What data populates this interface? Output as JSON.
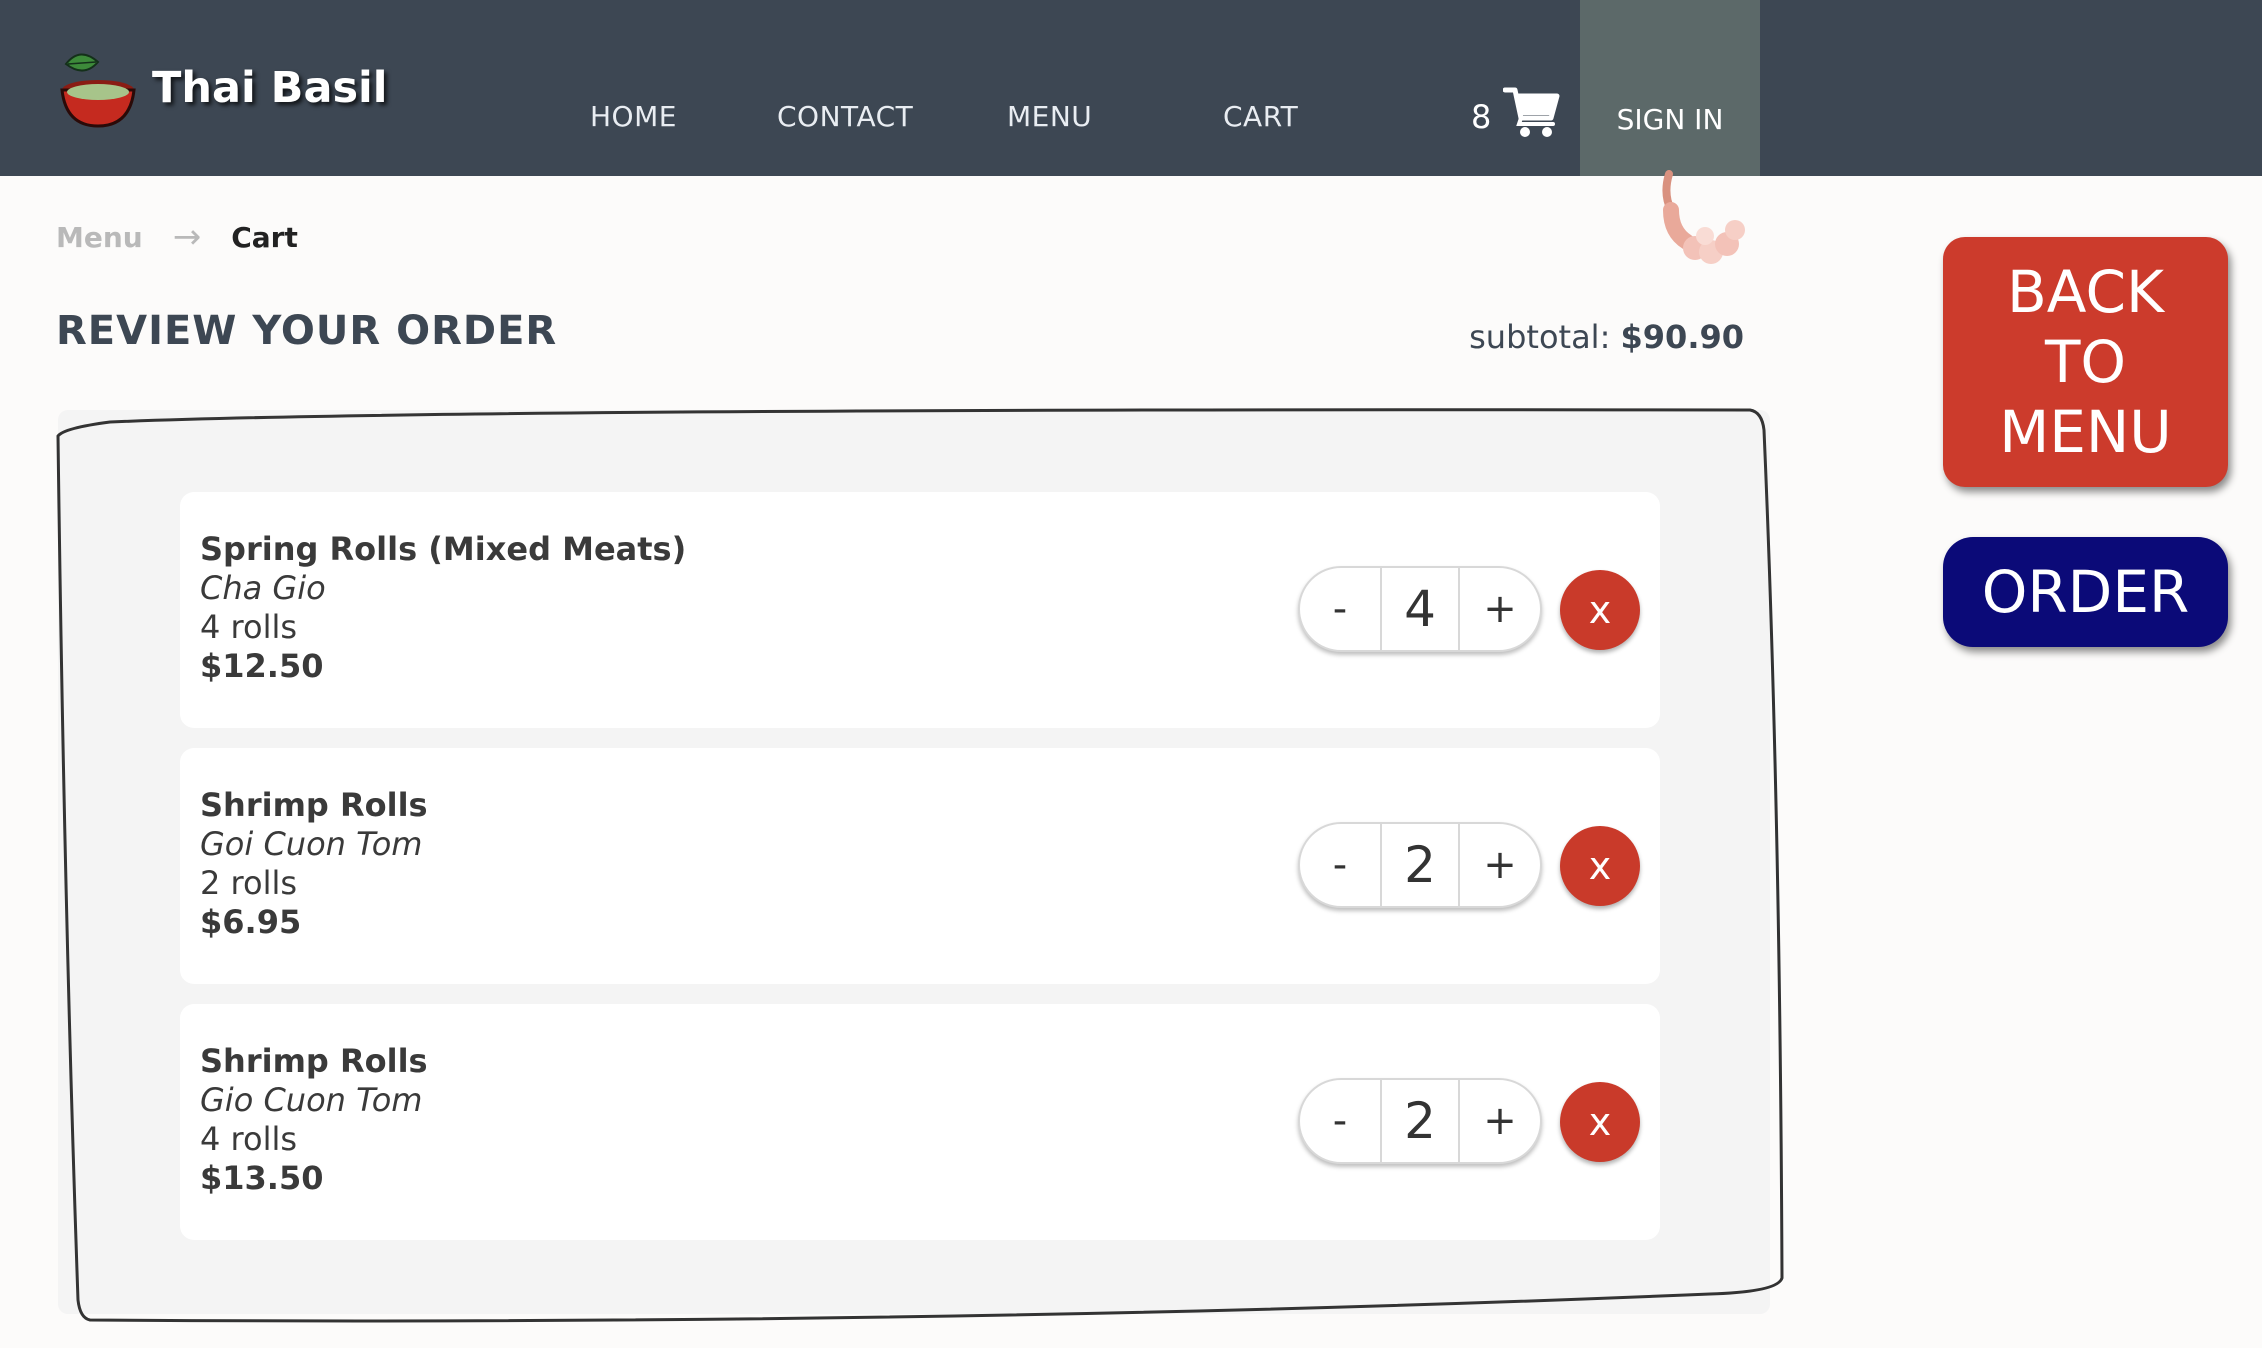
{
  "brand": {
    "name": "Thai Basil"
  },
  "nav": {
    "home": "HOME",
    "contact": "CONTACT",
    "menu": "MENU",
    "cart": "CART",
    "cart_count": "8",
    "sign_in": "SIGN IN"
  },
  "breadcrumb": {
    "menu": "Menu",
    "arrow": "→",
    "current": "Cart"
  },
  "page": {
    "title": "REVIEW YOUR ORDER",
    "subtotal_label": "subtotal: ",
    "subtotal_value": "$90.90"
  },
  "items": [
    {
      "name": "Spring Rolls (Mixed Meats)",
      "subname": "Cha Gio",
      "portion": "4 rolls",
      "price": "$12.50",
      "qty": "4",
      "minus": "-",
      "plus": "+",
      "remove": "x"
    },
    {
      "name": "Shrimp Rolls",
      "subname": "Goi Cuon Tom",
      "portion": "2 rolls",
      "price": "$6.95",
      "qty": "2",
      "minus": "-",
      "plus": "+",
      "remove": "x"
    },
    {
      "name": "Shrimp Rolls",
      "subname": "Gio Cuon Tom",
      "portion": "4 rolls",
      "price": "$13.50",
      "qty": "2",
      "minus": "-",
      "plus": "+",
      "remove": "x"
    }
  ],
  "actions": {
    "back_line1": "BACK",
    "back_line2": "TO",
    "back_line3": "MENU",
    "order": "ORDER"
  },
  "colors": {
    "nav_bg": "#3d4753",
    "signin_bg": "#5c6969",
    "back_button": "#cc3b2c",
    "order_button": "#0b0a78",
    "remove_button": "#c93a2a"
  }
}
